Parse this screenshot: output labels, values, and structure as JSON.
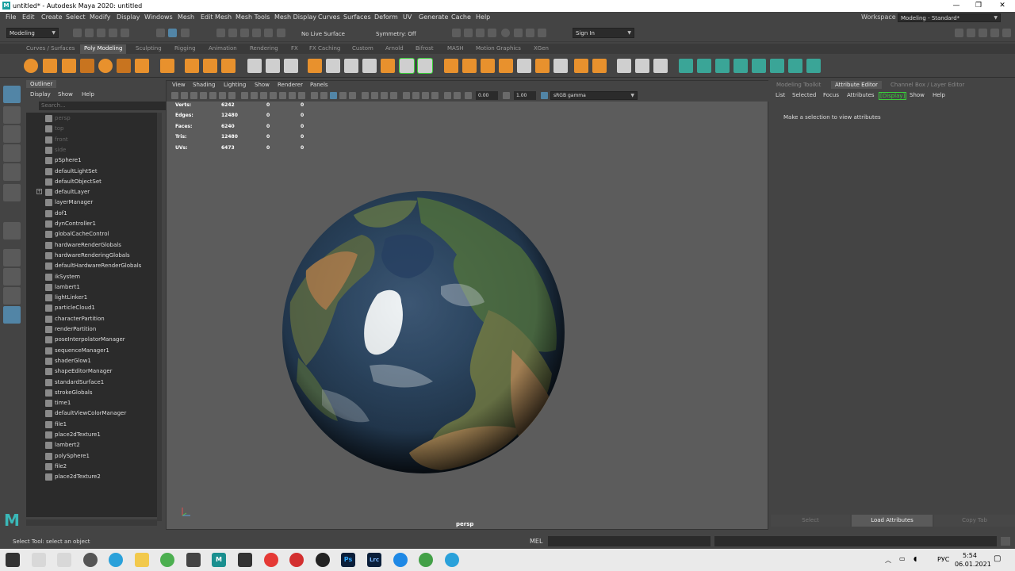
{
  "window": {
    "title": "untitled* - Autodesk Maya 2020: untitled",
    "logo": "M"
  },
  "menubar": [
    "File",
    "Edit",
    "Create",
    "Select",
    "Modify",
    "Display",
    "Windows",
    "Mesh",
    "Edit Mesh",
    "Mesh Tools",
    "Mesh Display",
    "Curves",
    "Surfaces",
    "Deform",
    "UV",
    "Generate",
    "Cache",
    "Help"
  ],
  "workspace": {
    "label": "Workspace :",
    "value": "Modeling - Standard*"
  },
  "statusline": {
    "mode": "Modeling",
    "live_surface": "No Live Surface",
    "symmetry": "Symmetry: Off",
    "sign_in": "Sign In"
  },
  "shelf_tabs": [
    "Curves / Surfaces",
    "Poly Modeling",
    "Sculpting",
    "Rigging",
    "Animation",
    "Rendering",
    "FX",
    "FX Caching",
    "Custom",
    "Arnold",
    "Bifrost",
    "MASH",
    "Motion Graphics",
    "XGen"
  ],
  "shelf_active_tab": "Poly Modeling",
  "outliner": {
    "tab": "Outliner",
    "menu": [
      "Display",
      "Show",
      "Help"
    ],
    "search_placeholder": "Search...",
    "items": [
      {
        "label": "persp",
        "dim": true
      },
      {
        "label": "top",
        "dim": true
      },
      {
        "label": "front",
        "dim": true
      },
      {
        "label": "side",
        "dim": true
      },
      {
        "label": "pSphere1"
      },
      {
        "label": "defaultLightSet"
      },
      {
        "label": "defaultObjectSet"
      },
      {
        "label": "defaultLayer",
        "expand": true
      },
      {
        "label": "layerManager"
      },
      {
        "label": "dof1"
      },
      {
        "label": "dynController1"
      },
      {
        "label": "globalCacheControl"
      },
      {
        "label": "hardwareRenderGlobals"
      },
      {
        "label": "hardwareRenderingGlobals"
      },
      {
        "label": "defaultHardwareRenderGlobals"
      },
      {
        "label": "ikSystem"
      },
      {
        "label": "lambert1"
      },
      {
        "label": "lightLinker1"
      },
      {
        "label": "particleCloud1"
      },
      {
        "label": "characterPartition"
      },
      {
        "label": "renderPartition"
      },
      {
        "label": "poseInterpolatorManager"
      },
      {
        "label": "sequenceManager1"
      },
      {
        "label": "shaderGlow1"
      },
      {
        "label": "shapeEditorManager"
      },
      {
        "label": "standardSurface1"
      },
      {
        "label": "strokeGlobals"
      },
      {
        "label": "time1"
      },
      {
        "label": "defaultViewColorManager"
      },
      {
        "label": "file1"
      },
      {
        "label": "place2dTexture1"
      },
      {
        "label": "lambert2"
      },
      {
        "label": "polySphere1"
      },
      {
        "label": "file2"
      },
      {
        "label": "place2dTexture2"
      }
    ]
  },
  "viewport": {
    "menu": [
      "View",
      "Shading",
      "Lighting",
      "Show",
      "Renderer",
      "Panels"
    ],
    "exposure": "0.00",
    "gamma": "1.00",
    "color_space": "sRGB gamma",
    "camera": "persp",
    "stats": [
      {
        "label": "Verts:",
        "v1": "6242",
        "v2": "0",
        "v3": "0"
      },
      {
        "label": "Edges:",
        "v1": "12480",
        "v2": "0",
        "v3": "0"
      },
      {
        "label": "Faces:",
        "v1": "6240",
        "v2": "0",
        "v3": "0"
      },
      {
        "label": "Tris:",
        "v1": "12480",
        "v2": "0",
        "v3": "0"
      },
      {
        "label": "UVs:",
        "v1": "6473",
        "v2": "0",
        "v3": "0"
      }
    ]
  },
  "attribute_editor": {
    "tabs": [
      "Modeling Toolkit",
      "Attribute Editor",
      "Channel Box / Layer Editor"
    ],
    "active_tab": "Attribute Editor",
    "menu": [
      "List",
      "Selected",
      "Focus",
      "Attributes",
      "Display",
      "Show",
      "Help"
    ],
    "message": "Make a selection to view attributes",
    "buttons": [
      "Select",
      "Load Attributes",
      "Copy Tab"
    ]
  },
  "commandline": {
    "help": "Select Tool: select an object",
    "lang": "MEL"
  },
  "taskbar": {
    "lang": "РУС",
    "time": "5:54",
    "date": "06.01.2021",
    "apps": [
      "Ps",
      "Lrc"
    ]
  },
  "colors": {
    "accent": "#5285a6",
    "bg": "#444444",
    "panel": "#2b2b2b",
    "highlight_green": "#3ad03a"
  }
}
